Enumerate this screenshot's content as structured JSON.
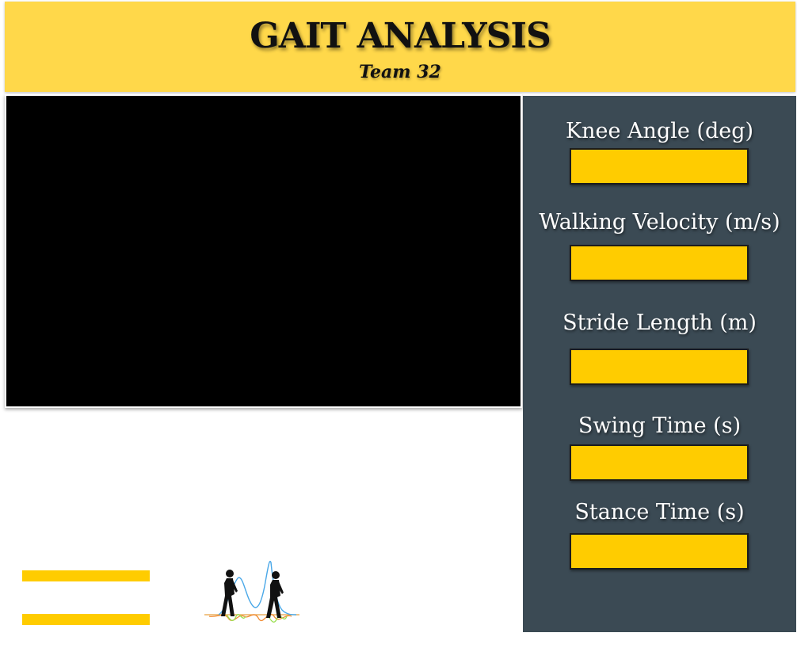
{
  "header": {
    "title": "GAIT ANALYSIS",
    "subtitle": "Team 32"
  },
  "metrics": [
    {
      "label": "Knee Angle (deg)",
      "value": ""
    },
    {
      "label": "Walking Velocity (m/s)",
      "value": ""
    },
    {
      "label": "Stride Length (m)",
      "value": ""
    },
    {
      "label": "Swing Time (s)",
      "value": ""
    },
    {
      "label": "Stance Time (s)",
      "value": ""
    }
  ],
  "colors": {
    "header_bg": "#ffd84a",
    "panel_bg": "#3b4a54",
    "accent": "#ffcc00",
    "video_bg": "#000000"
  },
  "icons": {
    "logo": "walking-figures-gait-wave-icon"
  }
}
